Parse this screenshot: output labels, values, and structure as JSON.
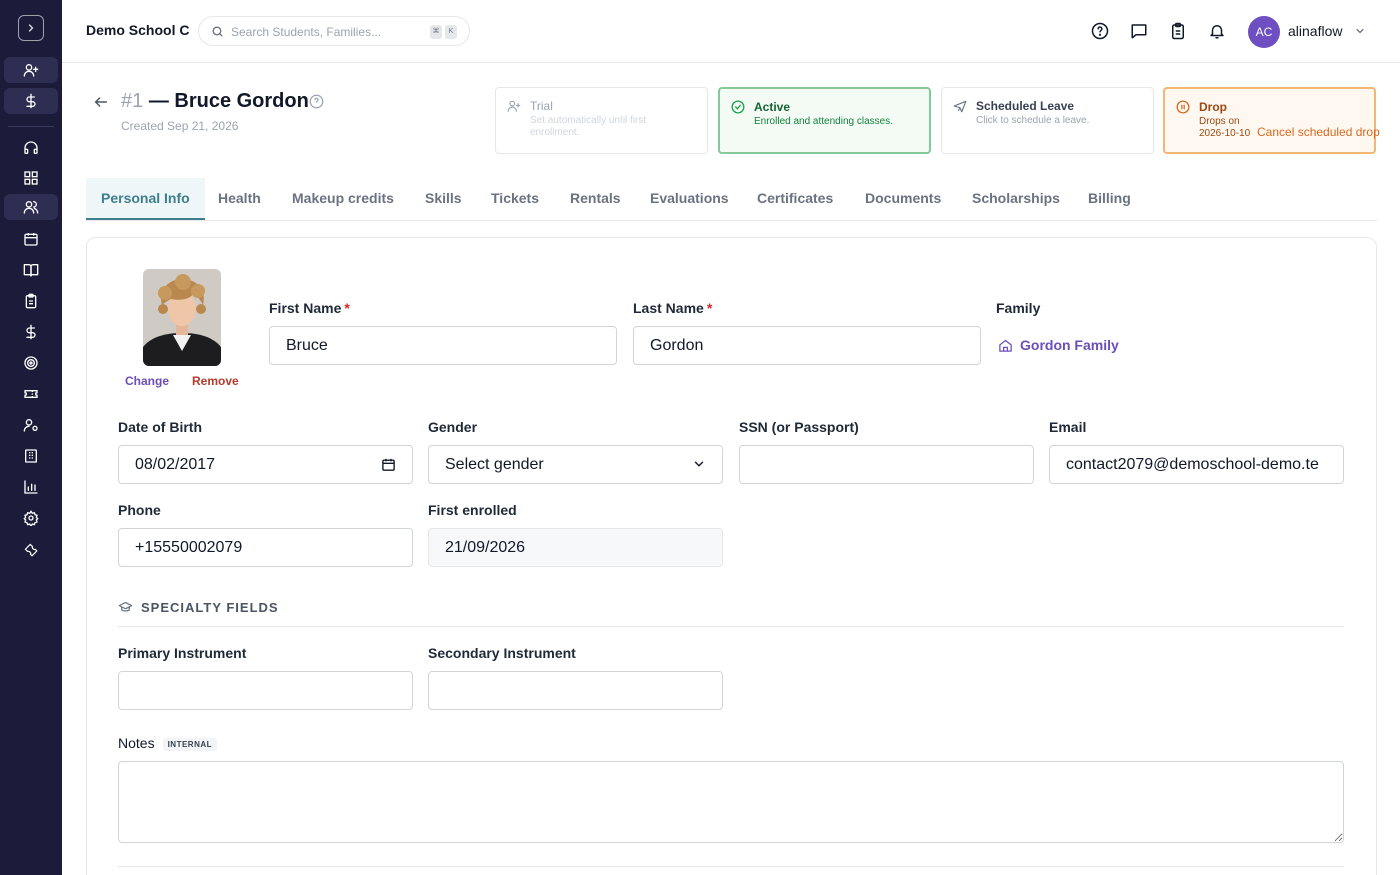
{
  "app": {
    "school_name": "Demo School C"
  },
  "search": {
    "placeholder": "Search Students, Families...",
    "kbd": [
      "⌘",
      "K"
    ]
  },
  "user": {
    "initials": "AC",
    "name": "alinaflow"
  },
  "sidebar": {
    "items": [
      {
        "icon": "user-plus-icon"
      },
      {
        "icon": "dollar-icon"
      },
      {
        "icon": "headset-icon"
      },
      {
        "icon": "dashboard-grid-icon"
      },
      {
        "icon": "users-icon"
      },
      {
        "icon": "calendar-icon"
      },
      {
        "icon": "book-open-icon"
      },
      {
        "icon": "clipboard-icon"
      },
      {
        "icon": "dollar-sign-icon"
      },
      {
        "icon": "target-icon"
      },
      {
        "icon": "ticket-icon"
      },
      {
        "icon": "user-cog-icon"
      },
      {
        "icon": "building-icon"
      },
      {
        "icon": "bar-chart-icon"
      },
      {
        "icon": "settings-icon"
      },
      {
        "icon": "wrench-icon"
      }
    ]
  },
  "student": {
    "number": "#1",
    "name_prefix": "—",
    "name": "Bruce Gordon",
    "created": "Created Sep 21, 2026"
  },
  "statuses": [
    {
      "key": "trial",
      "title": "Trial",
      "desc": "Set automatically until first enrollment."
    },
    {
      "key": "active",
      "title": "Active",
      "desc": "Enrolled and attending classes."
    },
    {
      "key": "scheduled",
      "title": "Scheduled Leave",
      "desc": "Click to schedule a leave."
    },
    {
      "key": "drop",
      "title": "Drop",
      "desc": "Drops on 2026-10-10",
      "action": "Cancel scheduled drop"
    }
  ],
  "tabs": [
    "Personal Info",
    "Health",
    "Makeup credits",
    "Skills",
    "Tickets",
    "Rentals",
    "Evaluations",
    "Certificates",
    "Documents",
    "Scholarships",
    "Billing"
  ],
  "photo": {
    "change": "Change",
    "remove": "Remove"
  },
  "form": {
    "first_name": {
      "label": "First Name",
      "req": "*",
      "value": "Bruce"
    },
    "last_name": {
      "label": "Last Name",
      "req": "*",
      "value": "Gordon"
    },
    "family": {
      "label": "Family",
      "value": "Gordon Family"
    },
    "dob": {
      "label": "Date of Birth",
      "value": "08/02/2017"
    },
    "gender": {
      "label": "Gender",
      "value": "Select gender"
    },
    "ssn": {
      "label": "SSN (or Passport)",
      "value": ""
    },
    "email": {
      "label": "Email",
      "value": "contact2079@demoschool-demo.te"
    },
    "phone": {
      "label": "Phone",
      "value": "+15550002079"
    },
    "first_enrolled": {
      "label": "First enrolled",
      "value": "21/09/2026"
    }
  },
  "specialty": {
    "heading": "SPECIALTY FIELDS",
    "primary": {
      "label": "Primary Instrument",
      "value": ""
    },
    "secondary": {
      "label": "Secondary Instrument",
      "value": ""
    }
  },
  "notes": {
    "label": "Notes",
    "badge": "INTERNAL",
    "value": ""
  },
  "colors": {
    "sidebar_bg": "#1c1b3a",
    "accent_teal": "#3f7e8c",
    "link_purple": "#6a4fb8",
    "remove_red": "#b43a2e",
    "drop_orange": "#d66a1f",
    "active_green": "#86c998"
  }
}
